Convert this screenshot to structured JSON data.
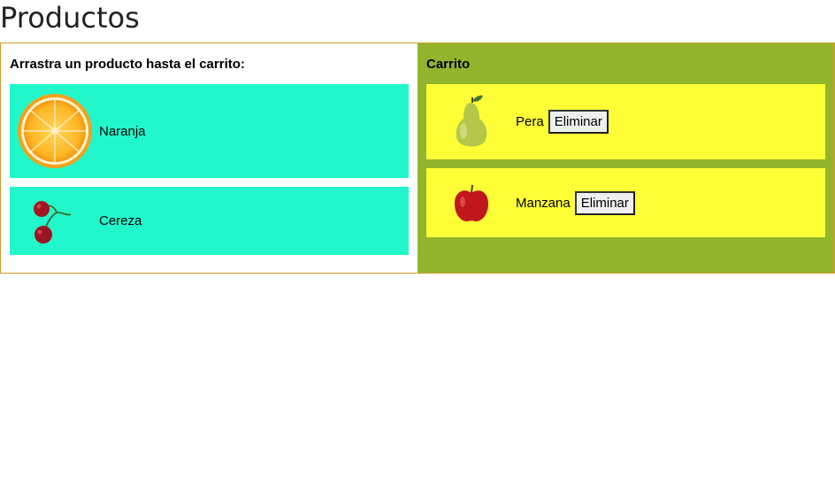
{
  "page": {
    "title": "Productos"
  },
  "products": {
    "heading": "Arrastra un producto hasta el carrito:",
    "items": [
      {
        "label": "Naranja",
        "icon": "orange-icon",
        "color": "#22f7cc"
      },
      {
        "label": "Cereza",
        "icon": "cherry-icon",
        "color": "#22f7cc"
      }
    ]
  },
  "cart": {
    "heading": "Carrito",
    "background": "#93b52d",
    "items": [
      {
        "label": "Pera",
        "icon": "pear-icon",
        "remove_label": "Eliminar",
        "color": "#ffff38"
      },
      {
        "label": "Manzana",
        "icon": "apple-icon",
        "remove_label": "Eliminar",
        "color": "#ffff38"
      }
    ]
  }
}
